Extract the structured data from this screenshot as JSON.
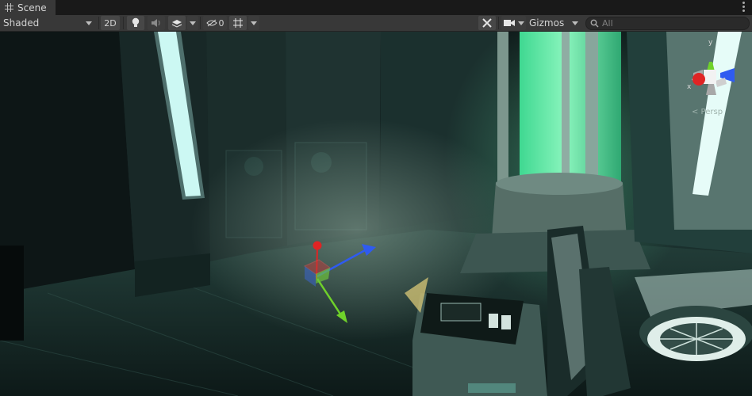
{
  "tab": {
    "label": "Scene",
    "menu_icon": "kebab-menu-icon",
    "icon": "grid-icon"
  },
  "toolbar": {
    "draw_mode": "Shaded",
    "mode_2d": "2D",
    "hidden_count": "0",
    "gizmos_label": "Gizmos",
    "search_placeholder": "All"
  },
  "gizmo": {
    "axis_y": "y",
    "axis_x": "x",
    "projection": "< Persp",
    "colors": {
      "x": "#e02424",
      "y": "#6fd12a",
      "z": "#2f5bf0"
    }
  }
}
